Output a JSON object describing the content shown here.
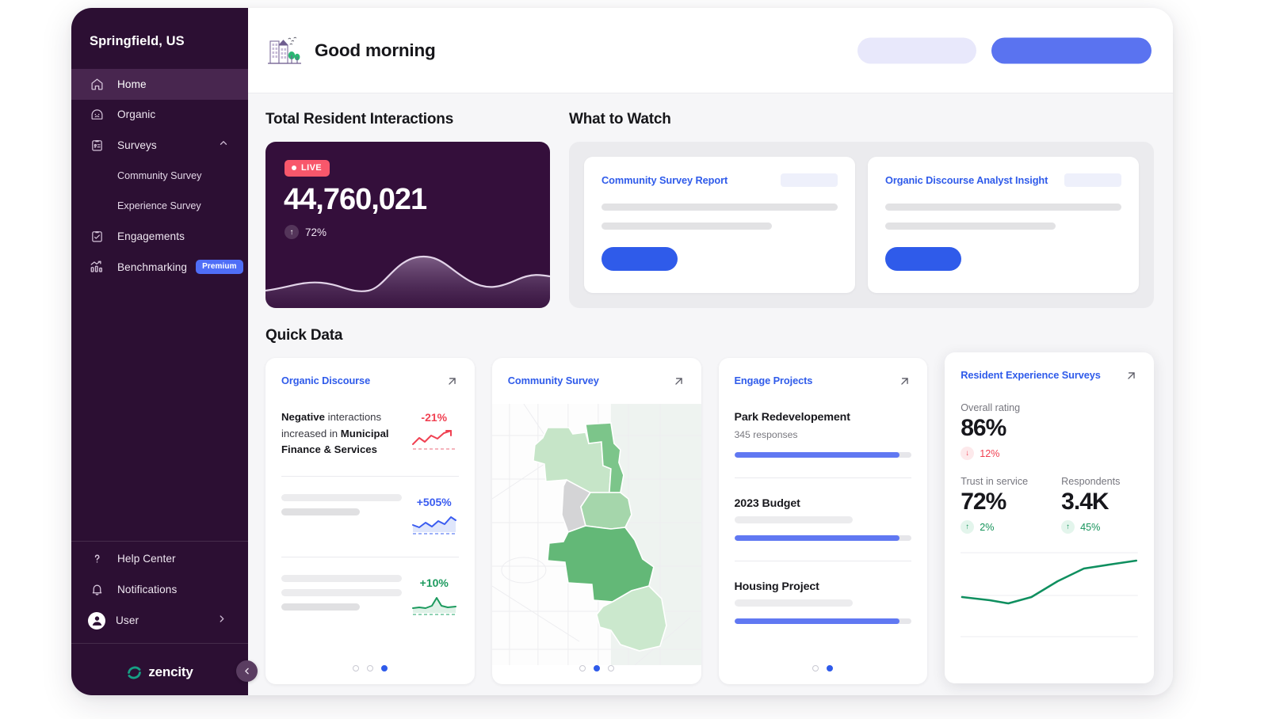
{
  "sidebar": {
    "org_name": "Springfield, US",
    "main_items": [
      {
        "label": "Home",
        "icon": "home-icon",
        "active": true
      },
      {
        "label": "Organic",
        "icon": "sentiment-face-icon",
        "active": false
      },
      {
        "label": "Surveys",
        "icon": "clipboard-survey-icon",
        "active": false,
        "expanded": true
      }
    ],
    "survey_children": [
      {
        "label": "Community Survey"
      },
      {
        "label": "Experience Survey"
      }
    ],
    "items_after": [
      {
        "label": "Engagements",
        "icon": "clipboard-check-icon"
      },
      {
        "label": "Benchmarking",
        "icon": "bar-chart-trend-icon",
        "badge": "Premium"
      }
    ],
    "bottom_items": [
      {
        "label": "Help Center",
        "icon": "question-mark-icon"
      },
      {
        "label": "Notifications",
        "icon": "bell-icon"
      },
      {
        "label": "User",
        "icon": "avatar-icon",
        "chevron": "chevron-right-icon"
      }
    ],
    "brand": "zencity",
    "collapse_icon": "chevron-left-icon"
  },
  "topbar": {
    "greeting": "Good morning",
    "greeting_icon": "city-buildings-trees-icon",
    "secondary_button_label": "",
    "primary_button_label": ""
  },
  "sections": {
    "total_interactions_title": "Total Resident Interactions",
    "what_to_watch_title": "What to Watch",
    "quick_data_title": "Quick Data"
  },
  "live_card": {
    "badge": "LIVE",
    "value": "44,760,021",
    "delta": "72%",
    "delta_direction": "up",
    "background": "#340f3b",
    "badge_color": "#f8576b"
  },
  "watch_cards": [
    {
      "title": "Community Survey Report",
      "button_label": ""
    },
    {
      "title": "Organic Discourse Analyst Insight",
      "button_label": ""
    }
  ],
  "quick_data": {
    "organic": {
      "title": "Organic Discourse",
      "expand_icon": "arrow-up-right-icon",
      "insight_prefix": "Negative",
      "insight_mid": " interactions increased in ",
      "insight_bold2": "Municipal Finance & Services",
      "insight_metric": "-21%",
      "rows": [
        {
          "metric": "+505%",
          "tone": "blue"
        },
        {
          "metric": "+10%",
          "tone": "pos"
        }
      ],
      "dots": 3,
      "active_dot": 2
    },
    "community_survey": {
      "title": "Community Survey",
      "expand_icon": "arrow-up-right-icon",
      "dots": 3,
      "active_dot": 1
    },
    "engage": {
      "title": "Engage Projects",
      "expand_icon": "arrow-up-right-icon",
      "projects": [
        {
          "name": "Park Redevelopement",
          "responses": "345 responses",
          "progress": 93
        },
        {
          "name": "2023 Budget",
          "responses": "",
          "progress": 93
        },
        {
          "name": "Housing Project",
          "responses": "",
          "progress": 93
        }
      ],
      "dots": 2,
      "active_dot": 1
    },
    "resident": {
      "title": "Resident Experience Surveys",
      "expand_icon": "arrow-up-right-icon",
      "overall_label": "Overall rating",
      "overall_value": "86%",
      "overall_delta": "12%",
      "overall_direction": "down",
      "trust_label": "Trust in service",
      "trust_value": "72%",
      "trust_delta": "2%",
      "trust_direction": "up",
      "respondents_label": "Respondents",
      "respondents_value": "3.4K",
      "respondents_delta": "45%",
      "respondents_direction": "up"
    }
  },
  "chart_data": [
    {
      "type": "area",
      "title": "Total Resident Interactions sparkline",
      "x": [
        0,
        1,
        2,
        3,
        4,
        5,
        6,
        7,
        8,
        9,
        10
      ],
      "values": [
        20,
        26,
        33,
        28,
        24,
        40,
        62,
        68,
        55,
        34,
        44
      ],
      "ylim": [
        0,
        80
      ],
      "series_color": "#d8c3df",
      "grid": false
    },
    {
      "type": "line",
      "title": "Organic Discourse negative trend",
      "values": [
        10,
        26,
        16,
        34,
        26,
        44,
        62
      ],
      "series_color": "#f04152",
      "grid": false
    },
    {
      "type": "line",
      "title": "Organic Discourse row 2 trend",
      "values": [
        28,
        22,
        34,
        24,
        38,
        30,
        52,
        46
      ],
      "series_color": "#3a5cf0",
      "grid": false
    },
    {
      "type": "line",
      "title": "Organic Discourse row 3 trend",
      "values": [
        18,
        20,
        19,
        24,
        62,
        30,
        26,
        28
      ],
      "series_color": "#1c9a5e",
      "grid": false
    },
    {
      "type": "line",
      "title": "Resident Experience Surveys trend",
      "x": [
        0,
        1,
        2,
        3,
        4,
        5,
        6
      ],
      "values": [
        40,
        37,
        34,
        38,
        52,
        64,
        70
      ],
      "ylim": [
        0,
        100
      ],
      "series_color": "#0f8f5f",
      "grid": true,
      "gridlines": 3
    },
    {
      "type": "heatmap",
      "title": "Community Survey regional map",
      "legend_position": "none",
      "regions": [
        {
          "name": "north-west",
          "value": 35,
          "color": "#c6e5c8"
        },
        {
          "name": "north-east",
          "value": 65,
          "color": "#7cc58a"
        },
        {
          "name": "north-coast",
          "value": 45,
          "color": "#a5d6ab"
        },
        {
          "name": "central",
          "value": 15,
          "color": "#d4d4d6"
        },
        {
          "name": "core",
          "value": 80,
          "color": "#63b877"
        },
        {
          "name": "south",
          "value": 30,
          "color": "#cbe8cd"
        }
      ]
    }
  ]
}
